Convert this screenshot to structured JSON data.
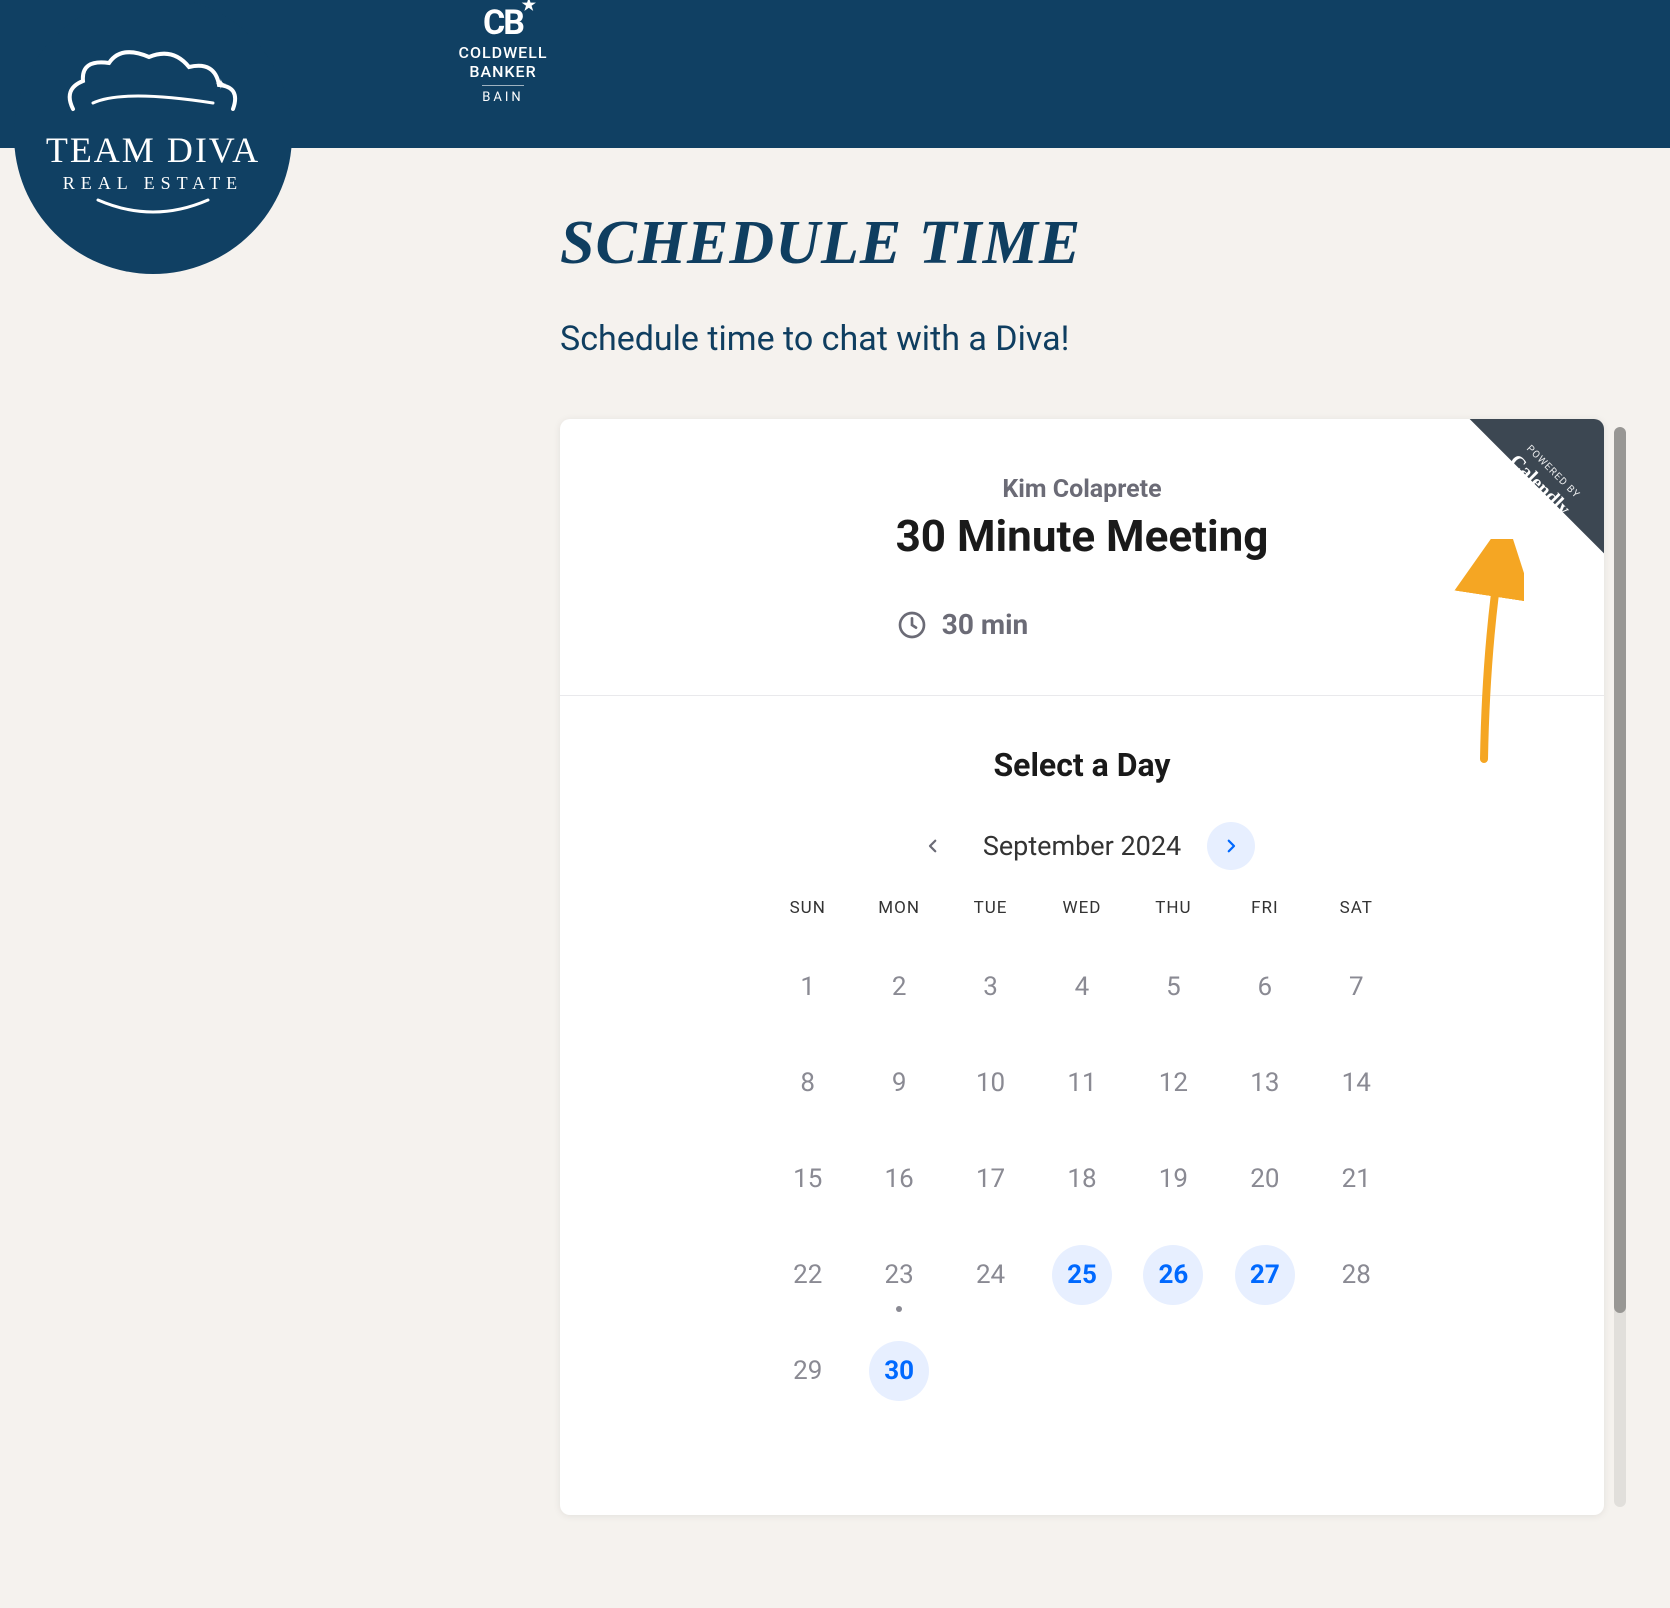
{
  "logo": {
    "brand": "TEAM DIVA",
    "sub": "REAL ESTATE"
  },
  "cb_logo": {
    "mark": "CB",
    "line1": "COLDWELL",
    "line2": "BANKER",
    "line3": "BAIN"
  },
  "page": {
    "title": "SCHEDULE TIME",
    "subtitle": "Schedule time to chat with a Diva!"
  },
  "widget": {
    "host": "Kim Colaprete",
    "meeting_title": "30 Minute Meeting",
    "duration": "30 min",
    "ribbon_small": "POWERED BY",
    "ribbon_big": "Calendly",
    "select_day": "Select a Day",
    "month": "September 2024",
    "dow": [
      "SUN",
      "MON",
      "TUE",
      "WED",
      "THU",
      "FRI",
      "SAT"
    ],
    "days": [
      {
        "n": "1",
        "avail": false,
        "today": false
      },
      {
        "n": "2",
        "avail": false,
        "today": false
      },
      {
        "n": "3",
        "avail": false,
        "today": false
      },
      {
        "n": "4",
        "avail": false,
        "today": false
      },
      {
        "n": "5",
        "avail": false,
        "today": false
      },
      {
        "n": "6",
        "avail": false,
        "today": false
      },
      {
        "n": "7",
        "avail": false,
        "today": false
      },
      {
        "n": "8",
        "avail": false,
        "today": false
      },
      {
        "n": "9",
        "avail": false,
        "today": false
      },
      {
        "n": "10",
        "avail": false,
        "today": false
      },
      {
        "n": "11",
        "avail": false,
        "today": false
      },
      {
        "n": "12",
        "avail": false,
        "today": false
      },
      {
        "n": "13",
        "avail": false,
        "today": false
      },
      {
        "n": "14",
        "avail": false,
        "today": false
      },
      {
        "n": "15",
        "avail": false,
        "today": false
      },
      {
        "n": "16",
        "avail": false,
        "today": false
      },
      {
        "n": "17",
        "avail": false,
        "today": false
      },
      {
        "n": "18",
        "avail": false,
        "today": false
      },
      {
        "n": "19",
        "avail": false,
        "today": false
      },
      {
        "n": "20",
        "avail": false,
        "today": false
      },
      {
        "n": "21",
        "avail": false,
        "today": false
      },
      {
        "n": "22",
        "avail": false,
        "today": false
      },
      {
        "n": "23",
        "avail": false,
        "today": true
      },
      {
        "n": "24",
        "avail": false,
        "today": false
      },
      {
        "n": "25",
        "avail": true,
        "today": false
      },
      {
        "n": "26",
        "avail": true,
        "today": false
      },
      {
        "n": "27",
        "avail": true,
        "today": false
      },
      {
        "n": "28",
        "avail": false,
        "today": false
      },
      {
        "n": "29",
        "avail": false,
        "today": false
      },
      {
        "n": "30",
        "avail": true,
        "today": false
      }
    ]
  }
}
